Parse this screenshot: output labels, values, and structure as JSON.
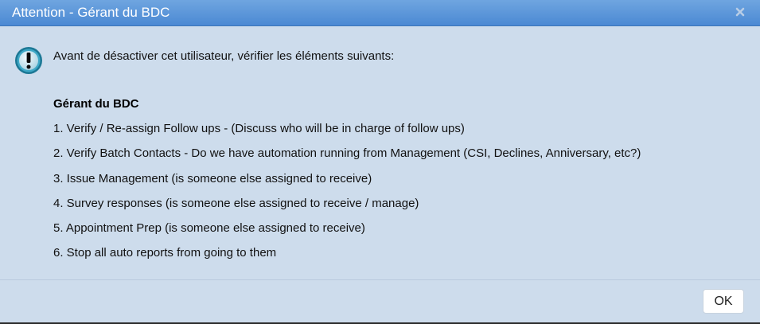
{
  "dialog": {
    "title": "Attention - Gérant du BDC",
    "close_icon": "close-icon",
    "intro": "Avant de désactiver cet utilisateur, vérifier les éléments suivants:",
    "section_heading": "Gérant du BDC",
    "items": [
      {
        "text": "1. Verify / Re-assign Follow ups - (Discuss who will be in charge of follow ups)"
      },
      {
        "text": "2. Verify Batch Contacts - Do we have automation running from Management (CSI, Declines, Anniversary, etc?)"
      },
      {
        "text": "3. Issue Management (is someone else assigned to receive)"
      },
      {
        "text": "4. Survey responses (is someone else assigned to receive / manage)"
      },
      {
        "text": "5. Appointment Prep (is someone else assigned to receive)"
      },
      {
        "text": "6. Stop all auto reports from going to them"
      }
    ],
    "ok_label": "OK",
    "icon": "info-exclamation-icon",
    "colors": {
      "titlebar": "#4b89d3",
      "body": "#cddcec",
      "icon_ring": "#1e7fa0"
    }
  }
}
